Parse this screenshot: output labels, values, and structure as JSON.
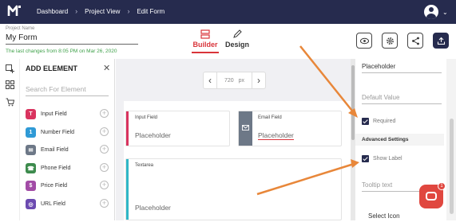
{
  "nav": {
    "breadcrumbs": [
      "Dashboard",
      "Project View",
      "Edit Form"
    ]
  },
  "header": {
    "project_name_label": "Project Name",
    "project_name": "My Form",
    "last_changes": "The last changes from 8:05 PM on Mar 26, 2020",
    "tabs": [
      {
        "label": "Builder",
        "active": true
      },
      {
        "label": "Design",
        "active": false
      }
    ]
  },
  "elements_panel": {
    "title": "ADD ELEMENT",
    "search_placeholder": "Search For Element",
    "items": [
      {
        "label": "Input Field",
        "icon": "input-icon",
        "color": "#d9345f"
      },
      {
        "label": "Number Field",
        "icon": "number-icon",
        "color": "#2f9ad6"
      },
      {
        "label": "Email Field",
        "icon": "email-icon",
        "color": "#6d7887"
      },
      {
        "label": "Phone Field",
        "icon": "phone-icon",
        "color": "#3d8b4d"
      },
      {
        "label": "Price Field",
        "icon": "dollar-icon",
        "color": "#a24ca6"
      },
      {
        "label": "URL Field",
        "icon": "globe-icon",
        "color": "#6b4ab0"
      }
    ]
  },
  "canvas": {
    "width_value": "720",
    "width_unit": "px",
    "cards": [
      {
        "label": "Input Field",
        "placeholder": "Placeholder"
      },
      {
        "label": "Email Field",
        "placeholder": "Placeholder"
      },
      {
        "label": "Textarea",
        "placeholder": "Placeholder"
      }
    ]
  },
  "properties": {
    "placeholder_value": "Placeholder",
    "default_value_placeholder": "Default Value",
    "required_label": "Required",
    "advanced_settings": "Advanced Settings",
    "show_label": "Show Label",
    "tooltip_placeholder": "Tooltip text",
    "select_icon": "Select Icon"
  },
  "chat": {
    "badge_count": "1"
  },
  "colors": {
    "topbar": "#262b4e",
    "accent_red": "#d9343a",
    "success_green": "#3fa14a",
    "annotation_orange": "#e8873a"
  }
}
